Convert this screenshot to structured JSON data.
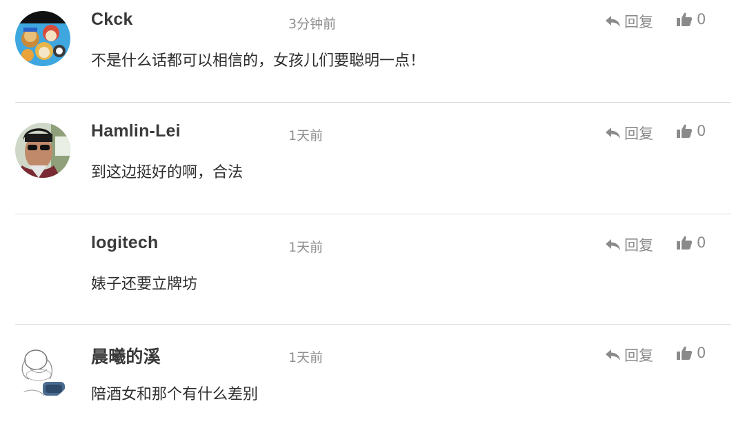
{
  "comments": [
    {
      "author": "Ckck",
      "time": "3分钟前",
      "text": "不是什么话都可以相信的，女孩儿们要聪明一点！",
      "reply_label": "回复",
      "likes": "0",
      "avatar": "cartoon-dogs"
    },
    {
      "author": "Hamlin-Lei",
      "time": "1天前",
      "text": "到这边挺好的啊，合法",
      "reply_label": "回复",
      "likes": "0",
      "avatar": "man-sunglasses"
    },
    {
      "author": "logitech",
      "time": "1天前",
      "text": "婊子还要立牌坊",
      "reply_label": "回复",
      "likes": "0",
      "avatar": "none"
    },
    {
      "author": "晨曦的溪",
      "time": "1天前",
      "text": "陪酒女和那个有什么差别",
      "reply_label": "回复",
      "likes": "0",
      "avatar": "sketch-figure"
    }
  ]
}
